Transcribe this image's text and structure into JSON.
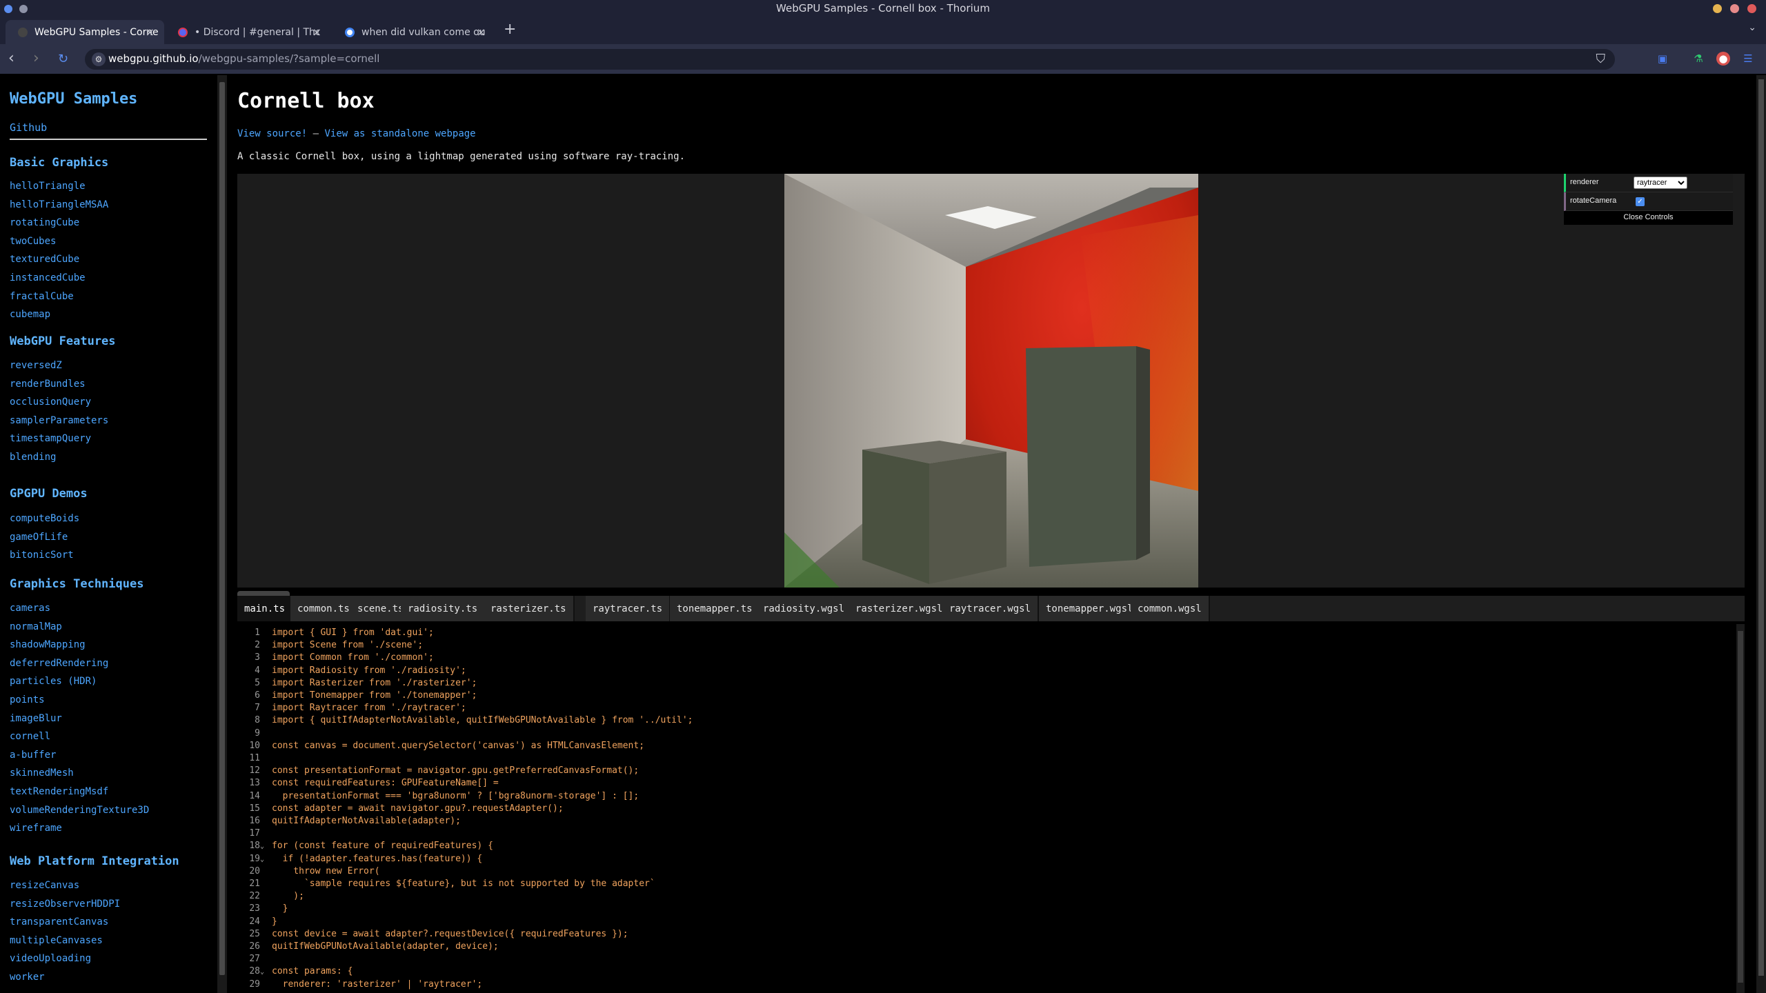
{
  "window": {
    "title": "WebGPU Samples - Cornell box - Thorium"
  },
  "tabs": [
    {
      "label": "WebGPU Samples - Cornell box",
      "favicon_color": "#444444"
    },
    {
      "label": "• Discord | #general | The",
      "favicon_color": "#5865f2"
    },
    {
      "label": "when did vulkan come out",
      "favicon_color": "#ffffff"
    }
  ],
  "address": {
    "host": "webgpu.github.io",
    "path": "/webgpu-samples/?sample=cornell"
  },
  "sidebar": {
    "brand": "WebGPU Samples",
    "github": "Github",
    "sections": [
      {
        "title": "Basic Graphics",
        "items": [
          "helloTriangle",
          "helloTriangleMSAA",
          "rotatingCube",
          "twoCubes",
          "texturedCube",
          "instancedCube",
          "fractalCube",
          "cubemap"
        ]
      },
      {
        "title": "WebGPU Features",
        "items": [
          "reversedZ",
          "renderBundles",
          "occlusionQuery",
          "samplerParameters",
          "timestampQuery",
          "blending"
        ]
      },
      {
        "title": "GPGPU Demos",
        "items": [
          "computeBoids",
          "gameOfLife",
          "bitonicSort"
        ]
      },
      {
        "title": "Graphics Techniques",
        "items": [
          "cameras",
          "normalMap",
          "shadowMapping",
          "deferredRendering",
          "particles (HDR)",
          "points",
          "imageBlur",
          "cornell",
          "a-buffer",
          "skinnedMesh",
          "textRenderingMsdf",
          "volumeRenderingTexture3D",
          "wireframe"
        ]
      },
      {
        "title": "Web Platform Integration",
        "items": [
          "resizeCanvas",
          "resizeObserverHDDPI",
          "transparentCanvas",
          "multipleCanvases",
          "videoUploading",
          "worker"
        ]
      }
    ]
  },
  "page": {
    "title": "Cornell box",
    "view_source": "View source!",
    "dash": "—",
    "standalone": "View as standalone webpage",
    "description": "A classic Cornell box, using a lightmap generated using software ray-tracing."
  },
  "gui": {
    "renderer_label": "renderer",
    "renderer_value": "raytracer",
    "rotate_label": "rotateCamera",
    "rotate_checked": true,
    "close": "Close Controls"
  },
  "files": [
    "main.ts",
    "common.ts",
    "scene.ts",
    "radiosity.ts",
    "rasterizer.ts",
    "raytracer.ts",
    "tonemapper.ts",
    "radiosity.wgsl",
    "rasterizer.wgsl",
    "raytracer.wgsl",
    "tonemapper.wgsl",
    "common.wgsl"
  ],
  "code_lines": [
    "import { GUI } from 'dat.gui';",
    "import Scene from './scene';",
    "import Common from './common';",
    "import Radiosity from './radiosity';",
    "import Rasterizer from './rasterizer';",
    "import Tonemapper from './tonemapper';",
    "import Raytracer from './raytracer';",
    "import { quitIfAdapterNotAvailable, quitIfWebGPUNotAvailable } from '../util';",
    "",
    "const canvas = document.querySelector('canvas') as HTMLCanvasElement;",
    "",
    "const presentationFormat = navigator.gpu.getPreferredCanvasFormat();",
    "const requiredFeatures: GPUFeatureName[] =",
    "  presentationFormat === 'bgra8unorm' ? ['bgra8unorm-storage'] : [];",
    "const adapter = await navigator.gpu?.requestAdapter();",
    "quitIfAdapterNotAvailable(adapter);",
    "",
    "for (const feature of requiredFeatures) {",
    "  if (!adapter.features.has(feature)) {",
    "    throw new Error(",
    "      `sample requires ${feature}, but is not supported by the adapter`",
    "    );",
    "  }",
    "}",
    "const device = await adapter?.requestDevice({ requiredFeatures });",
    "quitIfWebGPUNotAvailable(adapter, device);",
    "",
    "const params: {",
    "  renderer: 'rasterizer' | 'raytracer';"
  ],
  "code_folds": [
    18,
    19,
    28
  ]
}
